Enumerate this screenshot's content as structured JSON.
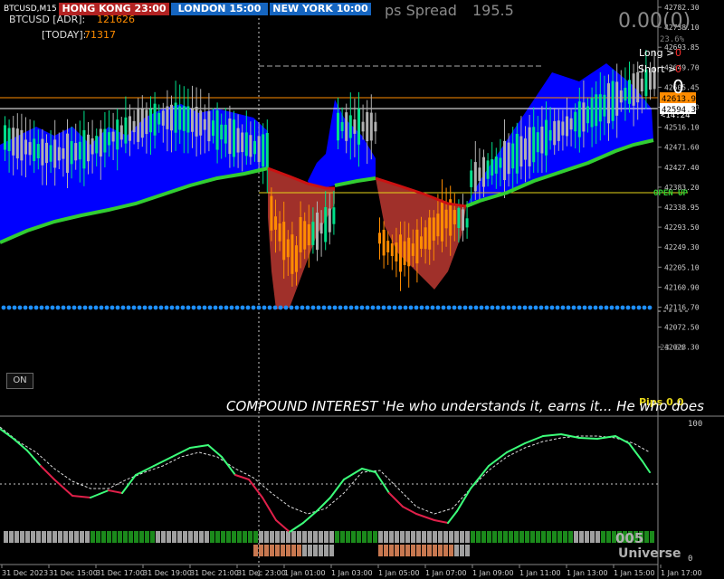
{
  "symbol_label": "BTCUSD,M15",
  "sessions": [
    {
      "name": "HONG KONG",
      "time": "23:00",
      "color": "#b22222"
    },
    {
      "name": "LONDON",
      "time": "15:00",
      "color": "#1565c0"
    },
    {
      "name": "NEW YORK",
      "time": "10:00",
      "color": "#1565c0"
    }
  ],
  "info": {
    "adr_label": "BTCUSD  [ADR]:",
    "adr_value": "121626",
    "today_label": "[TODAY]:",
    "today_value": "71317",
    "spread_label": "ps Spread",
    "spread_value": "195.5",
    "pnl": "0.00(0)",
    "long_label": "Long >",
    "long_value": "0",
    "short_label": "Short >",
    "short_value": "0",
    "position_count": "0",
    "countdown": "<14:24",
    "open_label": "OPEN UP",
    "pips_label": "Pips 0.0",
    "fib_top": "23.6%",
    "fib_bottom": "23.6%",
    "ticker_text": "COMPOUND INTEREST  'He who understands it, earns it... He who does",
    "brand_number": "005",
    "brand_name": "Universe",
    "on_button": "ON"
  },
  "price_axis": {
    "ticks": [
      "42782.30",
      "42738.10",
      "42693.85",
      "42649.70",
      "42605.45",
      "42560.30",
      "42516.10",
      "42471.60",
      "42427.40",
      "42383.20",
      "42338.95",
      "42293.50",
      "42249.30",
      "42205.10",
      "42160.90",
      "42116.70",
      "42072.50",
      "42028.30"
    ],
    "bid_price": "42613.93",
    "ask_price": "42594.38",
    "colors": {
      "bid": "#ff8c00",
      "ask": "#ffffff"
    }
  },
  "osc_axis": {
    "top": "100",
    "bottom": "0"
  },
  "time_axis": [
    "31 Dec 2023",
    "31 Dec 15:00",
    "31 Dec 17:00",
    "31 Dec 19:00",
    "31 Dec 21:00",
    "31 Dec 23:00",
    "1 Jan 01:00",
    "1 Jan 03:00",
    "1 Jan 05:00",
    "1 Jan 07:00",
    "1 Jan 09:00",
    "1 Jan 11:00",
    "1 Jan 13:00",
    "1 Jan 15:00",
    "1 Jan 17:00"
  ],
  "colors": {
    "bull_band": "#0000ff",
    "bear_band": "#a0302a",
    "ma_line": "#32cd32",
    "bull_candle": "#00e08a",
    "bear_candle": "#b0b0b0",
    "orange_candle": "#ff8c00",
    "dots": "#1e90ff",
    "osc_up": "#3cff7a",
    "osc_down": "#e0204a",
    "bar_green": "#1b8a1b",
    "bar_grey": "#a0a0a0",
    "bar_brown": "#c87850"
  }
}
